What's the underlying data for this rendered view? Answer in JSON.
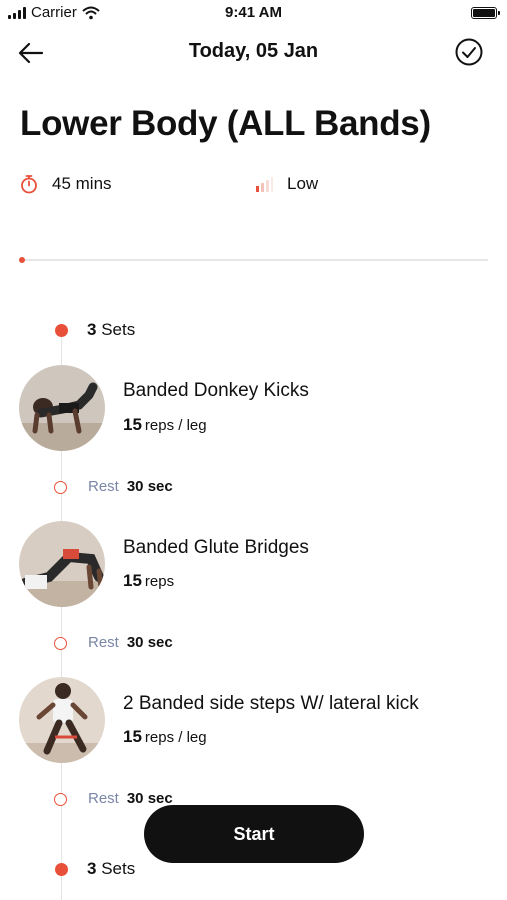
{
  "status_bar": {
    "carrier": "Carrier",
    "time": "9:41 AM"
  },
  "header": {
    "date": "Today, 05 Jan"
  },
  "workout": {
    "title": "Lower Body (ALL Bands)",
    "duration": "45 mins",
    "intensity": "Low",
    "progress": 0
  },
  "timeline": {
    "sets_1": {
      "count": "3",
      "label": "Sets"
    },
    "exercises": [
      {
        "name": "Banded Donkey Kicks",
        "reps": "15",
        "unit": "reps / leg",
        "rest_label": "Rest",
        "rest_value": "30 sec"
      },
      {
        "name": "Banded Glute Bridges",
        "reps": "15",
        "unit": "reps",
        "rest_label": "Rest",
        "rest_value": "30 sec"
      },
      {
        "name": "2 Banded side steps W/ lateral kick",
        "reps": "15",
        "unit": "reps / leg",
        "rest_label": "Rest",
        "rest_value": "30 sec"
      }
    ],
    "sets_2": {
      "count": "3",
      "label": "Sets"
    }
  },
  "actions": {
    "start_label": "Start"
  },
  "colors": {
    "accent": "#e8503a",
    "rest_label": "#7a86a6",
    "button": "#111111"
  }
}
